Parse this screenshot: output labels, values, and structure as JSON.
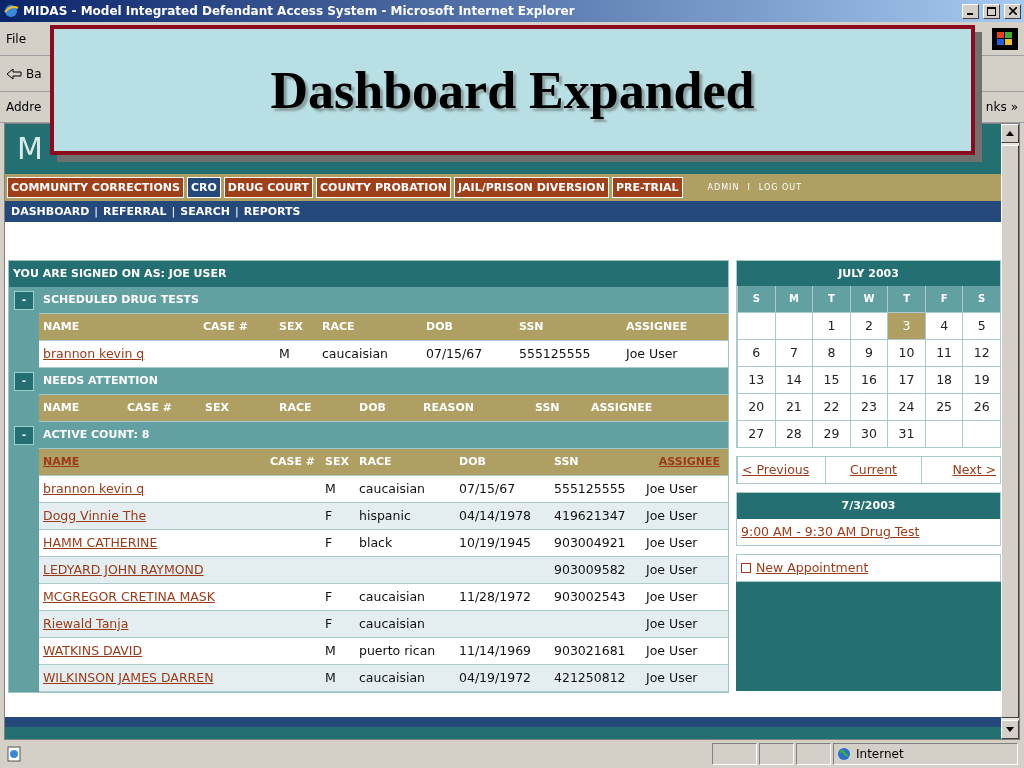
{
  "browser": {
    "title": "MIDAS - Model Integrated Defendant Access System - Microsoft Internet Explorer",
    "menu": [
      "File"
    ],
    "back": "Ba",
    "address_label": "Addre",
    "links": "nks",
    "links_more": "»",
    "status": "Internet"
  },
  "slide_title": "Dashboard Expanded",
  "site": {
    "title": "M",
    "program_tabs": [
      {
        "label": "COMMUNITY CORRECTIONS",
        "selected": false
      },
      {
        "label": "CRO",
        "selected": true
      },
      {
        "label": "DRUG COURT",
        "selected": false
      },
      {
        "label": "COUNTY PROBATION",
        "selected": false
      },
      {
        "label": "JAIL/PRISON DIVERSION",
        "selected": false
      },
      {
        "label": "PRE-TRIAL",
        "selected": false
      }
    ],
    "admin_links": [
      "ADMIN",
      "LOG OUT"
    ],
    "admin_separator": "I",
    "subnav": [
      "DASHBOARD",
      "REFERRAL",
      "SEARCH",
      "REPORTS"
    ],
    "subnav_separator": "|"
  },
  "dashboard": {
    "signed_on": "YOU ARE SIGNED ON AS: JOE USER",
    "sections": [
      {
        "title": "SCHEDULED DRUG TESTS",
        "toggle": "-",
        "expanded": true,
        "kind": "scheduled",
        "columns": [
          {
            "label": "NAME",
            "sortable": false
          },
          {
            "label": "CASE #",
            "sortable": false
          },
          {
            "label": "SEX",
            "sortable": false
          },
          {
            "label": "RACE",
            "sortable": false
          },
          {
            "label": "DOB",
            "sortable": false
          },
          {
            "label": "SSN",
            "sortable": false
          },
          {
            "label": "ASSIGNEE",
            "sortable": false
          }
        ],
        "rows": [
          {
            "name": "brannon kevin q",
            "sex": "M",
            "race": "caucaisian",
            "dob": "07/15/67",
            "ssn": "555125555",
            "assignee": "Joe User"
          }
        ]
      },
      {
        "title": "NEEDS ATTENTION",
        "toggle": "-",
        "expanded": true,
        "kind": "attention",
        "columns": [
          {
            "label": "NAME",
            "sortable": false
          },
          {
            "label": "CASE #",
            "sortable": false
          },
          {
            "label": "SEX",
            "sortable": false
          },
          {
            "label": "RACE",
            "sortable": false
          },
          {
            "label": "DOB",
            "sortable": false
          },
          {
            "label": "REASON",
            "sortable": false
          },
          {
            "label": "SSN",
            "sortable": false
          },
          {
            "label": "ASSIGNEE",
            "sortable": false
          }
        ]
      },
      {
        "title": "ACTIVE COUNT: 8",
        "toggle": "-",
        "expanded": true,
        "kind": "active",
        "columns": [
          {
            "label": "NAME",
            "sortable": true
          },
          {
            "label": "CASE #",
            "sortable": false
          },
          {
            "label": "SEX",
            "sortable": false
          },
          {
            "label": "RACE",
            "sortable": false
          },
          {
            "label": "DOB",
            "sortable": false
          },
          {
            "label": "SSN",
            "sortable": false
          },
          {
            "label": "ASSIGNEE",
            "sortable": true
          }
        ],
        "rows": [
          {
            "name": "brannon kevin q",
            "sex": "M",
            "race": "caucaisian",
            "dob": "07/15/67",
            "ssn": "555125555",
            "assignee": "Joe User"
          },
          {
            "name": "Dogg Vinnie The",
            "sex": "F",
            "race": "hispanic",
            "dob": "04/14/1978",
            "ssn": "419621347",
            "assignee": "Joe User"
          },
          {
            "name": "HAMM CATHERINE",
            "sex": "F",
            "race": "black",
            "dob": "10/19/1945",
            "ssn": "903004921",
            "assignee": "Joe User"
          },
          {
            "name": "LEDYARD JOHN RAYMOND",
            "ssn": "903009582",
            "assignee": "Joe User"
          },
          {
            "name": "MCGREGOR CRETINA MASK",
            "sex": "F",
            "race": "caucaisian",
            "dob": "11/28/1972",
            "ssn": "903002543",
            "assignee": "Joe User"
          },
          {
            "name": "Riewald Tanja",
            "sex": "F",
            "race": "caucaisian",
            "assignee": "Joe User"
          },
          {
            "name": "WATKINS DAVID",
            "sex": "M",
            "race": "puerto rican",
            "dob": "11/14/1969",
            "ssn": "903021681",
            "assignee": "Joe User"
          },
          {
            "name": "WILKINSON JAMES DARREN",
            "sex": "M",
            "race": "caucaisian",
            "dob": "04/19/1972",
            "ssn": "421250812",
            "assignee": "Joe User"
          }
        ]
      }
    ]
  },
  "calendar": {
    "title": "JULY 2003",
    "weekdays": [
      "S",
      "M",
      "T",
      "W",
      "T",
      "F",
      "S"
    ],
    "weeks": [
      [
        {
          "kind": "blank"
        },
        {
          "kind": "blank"
        },
        {
          "kind": "day",
          "label": "1",
          "selected": false
        },
        {
          "kind": "day",
          "label": "2",
          "selected": false
        },
        {
          "kind": "day",
          "label": "3",
          "selected": true
        },
        {
          "kind": "day",
          "label": "4",
          "selected": false
        },
        {
          "kind": "day",
          "label": "5",
          "selected": false
        }
      ],
      [
        {
          "kind": "day",
          "label": "6",
          "selected": false
        },
        {
          "kind": "day",
          "label": "7",
          "selected": false
        },
        {
          "kind": "day",
          "label": "8",
          "selected": false
        },
        {
          "kind": "day",
          "label": "9",
          "selected": false
        },
        {
          "kind": "day",
          "label": "10",
          "selected": false
        },
        {
          "kind": "day",
          "label": "11",
          "selected": false
        },
        {
          "kind": "day",
          "label": "12",
          "selected": false
        }
      ],
      [
        {
          "kind": "day",
          "label": "13",
          "selected": false
        },
        {
          "kind": "day",
          "label": "14",
          "selected": false
        },
        {
          "kind": "day",
          "label": "15",
          "selected": false
        },
        {
          "kind": "day",
          "label": "16",
          "selected": false
        },
        {
          "kind": "day",
          "label": "17",
          "selected": false
        },
        {
          "kind": "day",
          "label": "18",
          "selected": false
        },
        {
          "kind": "day",
          "label": "19",
          "selected": false
        }
      ],
      [
        {
          "kind": "day",
          "label": "20",
          "selected": false
        },
        {
          "kind": "day",
          "label": "21",
          "selected": false
        },
        {
          "kind": "day",
          "label": "22",
          "selected": false
        },
        {
          "kind": "day",
          "label": "23",
          "selected": false
        },
        {
          "kind": "day",
          "label": "24",
          "selected": false
        },
        {
          "kind": "day",
          "label": "25",
          "selected": false
        },
        {
          "kind": "day",
          "label": "26",
          "selected": false
        }
      ],
      [
        {
          "kind": "day",
          "label": "27",
          "selected": false
        },
        {
          "kind": "day",
          "label": "28",
          "selected": false
        },
        {
          "kind": "day",
          "label": "29",
          "selected": false
        },
        {
          "kind": "day",
          "label": "30",
          "selected": false
        },
        {
          "kind": "day",
          "label": "31",
          "selected": false
        },
        {
          "kind": "blank"
        },
        {
          "kind": "blank"
        }
      ]
    ],
    "nav": [
      "< Previous",
      "Current",
      "Next >"
    ],
    "day_title": "7/3/2003",
    "appointments": [
      "9:00 AM - 9:30 AM Drug Test"
    ],
    "new_appointment": "New Appointment"
  }
}
